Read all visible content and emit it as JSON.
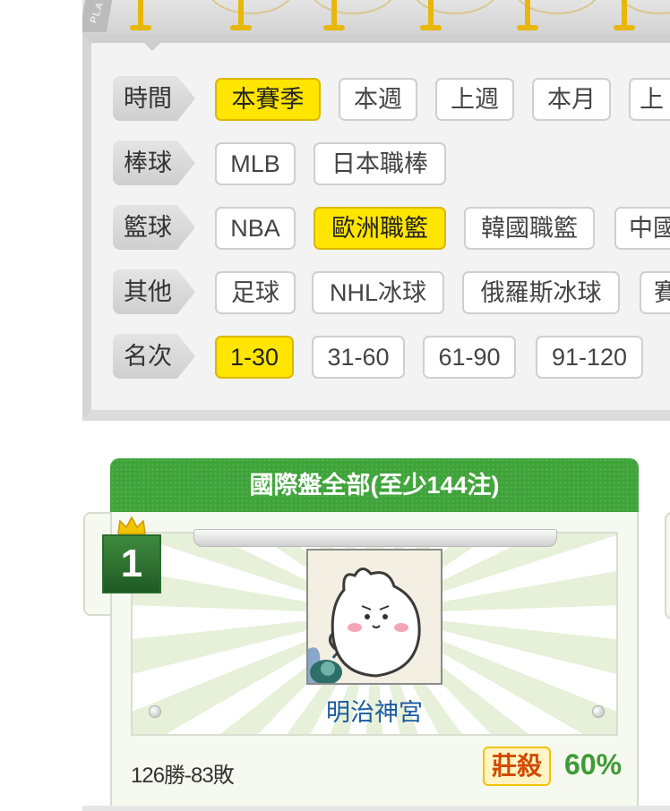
{
  "banner": {
    "ribbon_text": "PLA"
  },
  "filters": {
    "rows": [
      {
        "category": "時間",
        "options": [
          "本賽季",
          "本週",
          "上週",
          "本月",
          "上"
        ],
        "active": 0
      },
      {
        "category": "棒球",
        "options": [
          "MLB",
          "日本職棒"
        ],
        "active": -1
      },
      {
        "category": "籃球",
        "options": [
          "NBA",
          "歐洲職籃",
          "韓國職籃",
          "中國"
        ],
        "active": 1
      },
      {
        "category": "其他",
        "options": [
          "足球",
          "NHL冰球",
          "俄羅斯冰球",
          "賽"
        ],
        "active": -1
      },
      {
        "category": "名次",
        "options": [
          "1-30",
          "31-60",
          "61-90",
          "91-120"
        ],
        "active": 0
      }
    ]
  },
  "ranking": {
    "title": "國際盤全部(至少144注)",
    "rank": "1",
    "player_name": "明治神宮",
    "record": "126勝-83敗",
    "badge": "莊殺",
    "win_pct": "60%",
    "colors": {
      "header_green": "#3fa33a",
      "accent_yellow": "#ffe500",
      "name_blue": "#1b5aa0",
      "pct_green": "#3e9a36"
    }
  },
  "icons": [
    "crown-icon",
    "avatar-image"
  ]
}
